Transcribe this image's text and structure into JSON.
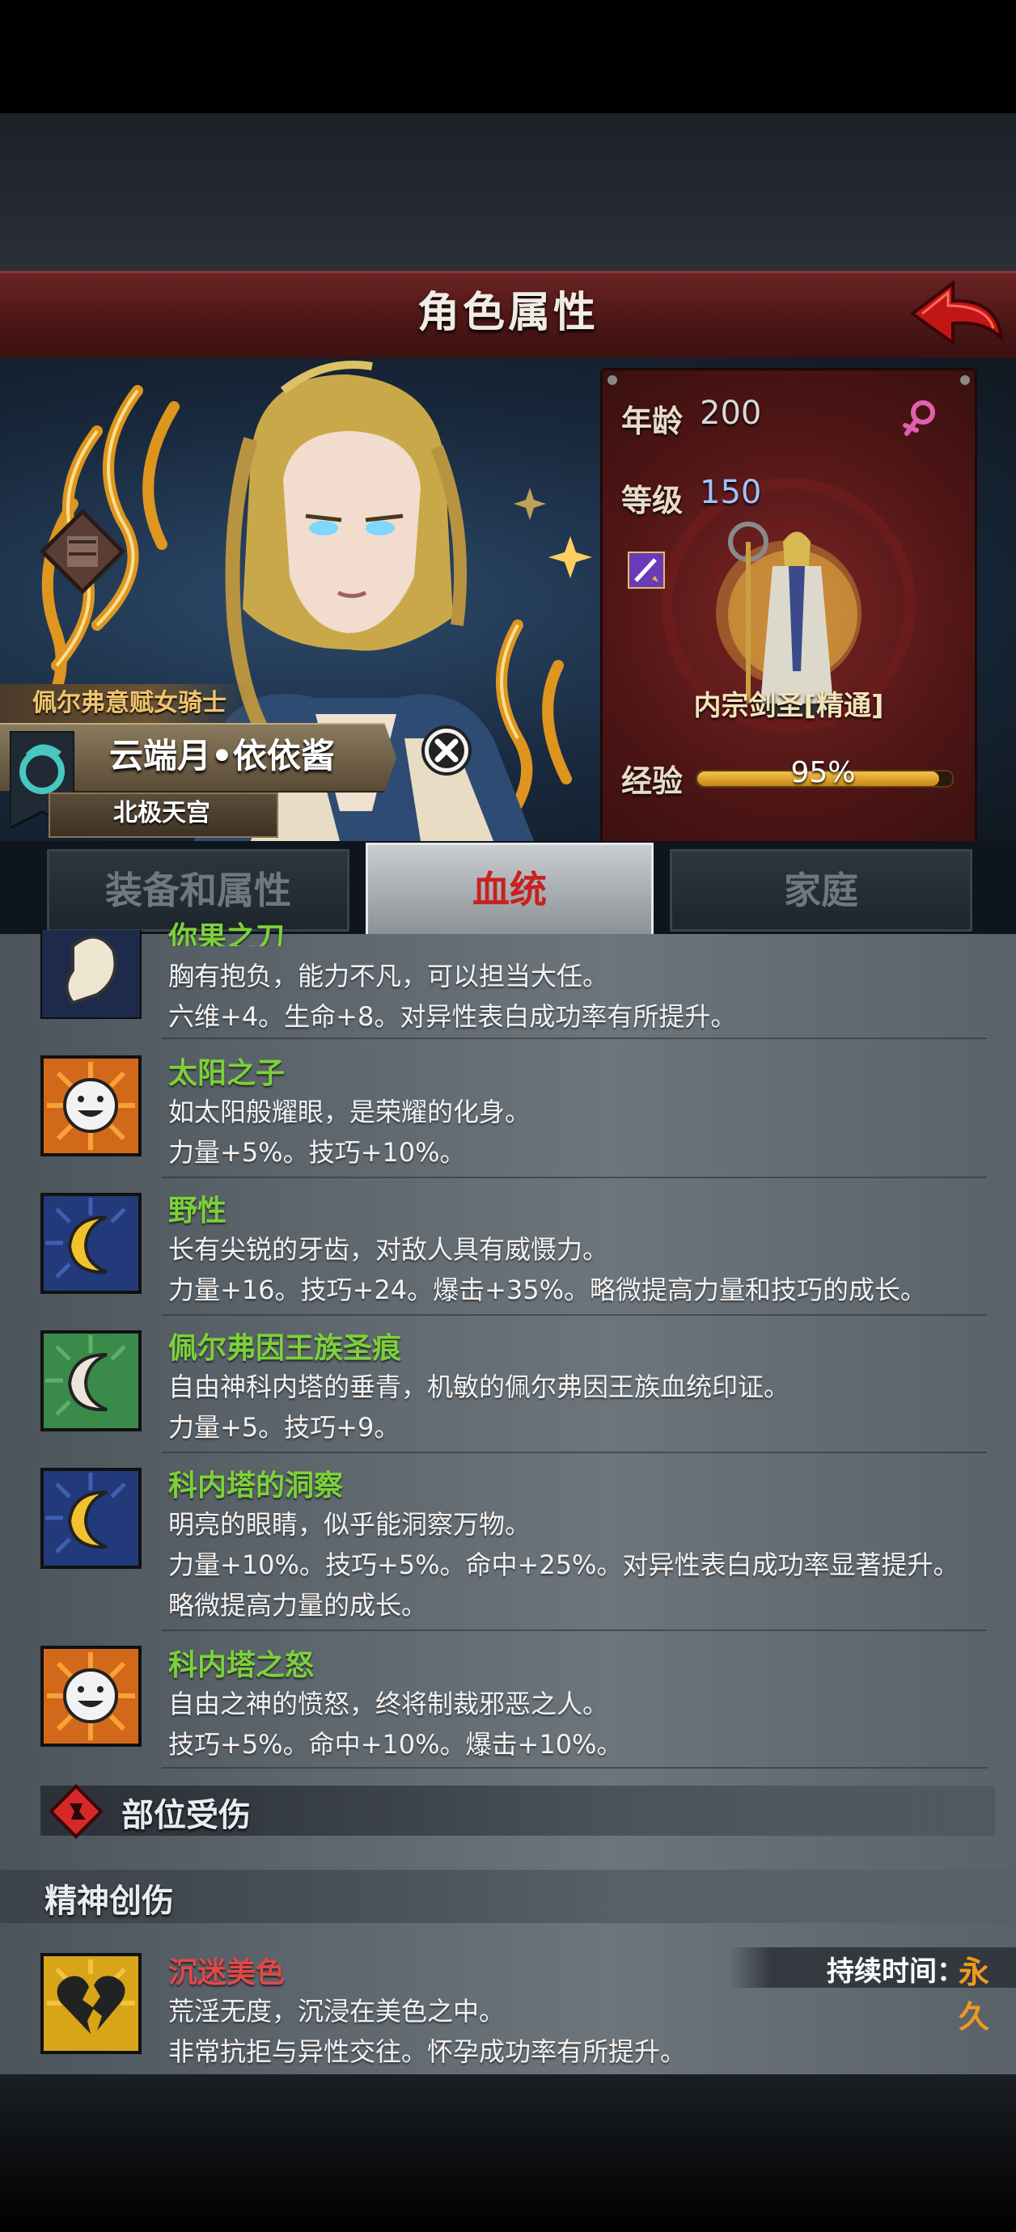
{
  "header": {
    "title": "角色属性"
  },
  "character": {
    "title": "佩尔弗意赋女骑士",
    "name": "云端月•依依酱",
    "location": "北极天宫"
  },
  "stats": {
    "age_label": "年龄",
    "age_value": "200",
    "level_label": "等级",
    "level_value": "150",
    "class_name": "内宗剑圣[精通]",
    "exp_label": "经验",
    "exp_value": "95%",
    "exp_fraction": 0.95
  },
  "tabs": [
    {
      "label": "装备和属性"
    },
    {
      "label": "血统"
    },
    {
      "label": "家庭"
    }
  ],
  "active_tab": "血统",
  "traits": [
    {
      "name": "你果之刀",
      "desc": "胸有抱负，能力不凡，可以担当大任。",
      "effect": "六维+4。生命+8。对异性表白成功率有所提升。",
      "icon": "arm-icon"
    },
    {
      "name": "太阳之子",
      "desc": "如太阳般耀眼，是荣耀的化身。",
      "effect": "力量+5%。技巧+10%。",
      "icon": "sun-face-icon"
    },
    {
      "name": "野性",
      "desc": "长有尖锐的牙齿，对敌人具有威慑力。",
      "effect": "力量+16。技巧+24。爆击+35%。略微提高力量和技巧的成长。",
      "icon": "moon-icon"
    },
    {
      "name": "佩尔弗因王族圣痕",
      "desc": "自由神科内塔的垂青，机敏的佩尔弗因王族血统印证。",
      "effect": "力量+5。技巧+9。",
      "icon": "white-moon-icon"
    },
    {
      "name": "科内塔的洞察",
      "desc": "明亮的眼睛，似乎能洞察万物。",
      "effect": "力量+10%。技巧+5%。命中+25%。对异性表白成功率显著提升。",
      "effect2": "略微提高力量的成长。",
      "icon": "moon-icon"
    },
    {
      "name": "科内塔之怒",
      "desc": "自由之神的愤怒，终将制裁邪恶之人。",
      "effect": "技巧+5%。命中+10%。爆击+10%。",
      "icon": "sun-face-icon"
    }
  ],
  "injury": {
    "title": "部位受伤"
  },
  "mental": {
    "title": "精神创伤",
    "duration_label": "持续时间：",
    "duration_value": "永久",
    "item": {
      "name": "沉迷美色",
      "desc": "荒淫无度，沉浸在美色之中。",
      "effect": "非常抗拒与异性交往。怀孕成功率有所提升。",
      "icon": "broken-heart-icon"
    }
  },
  "colors": {
    "accent_red": "#c8211f",
    "trait_green": "#7bd13b",
    "debuff_red": "#e04848",
    "exp_gold": "#f6c24a"
  }
}
